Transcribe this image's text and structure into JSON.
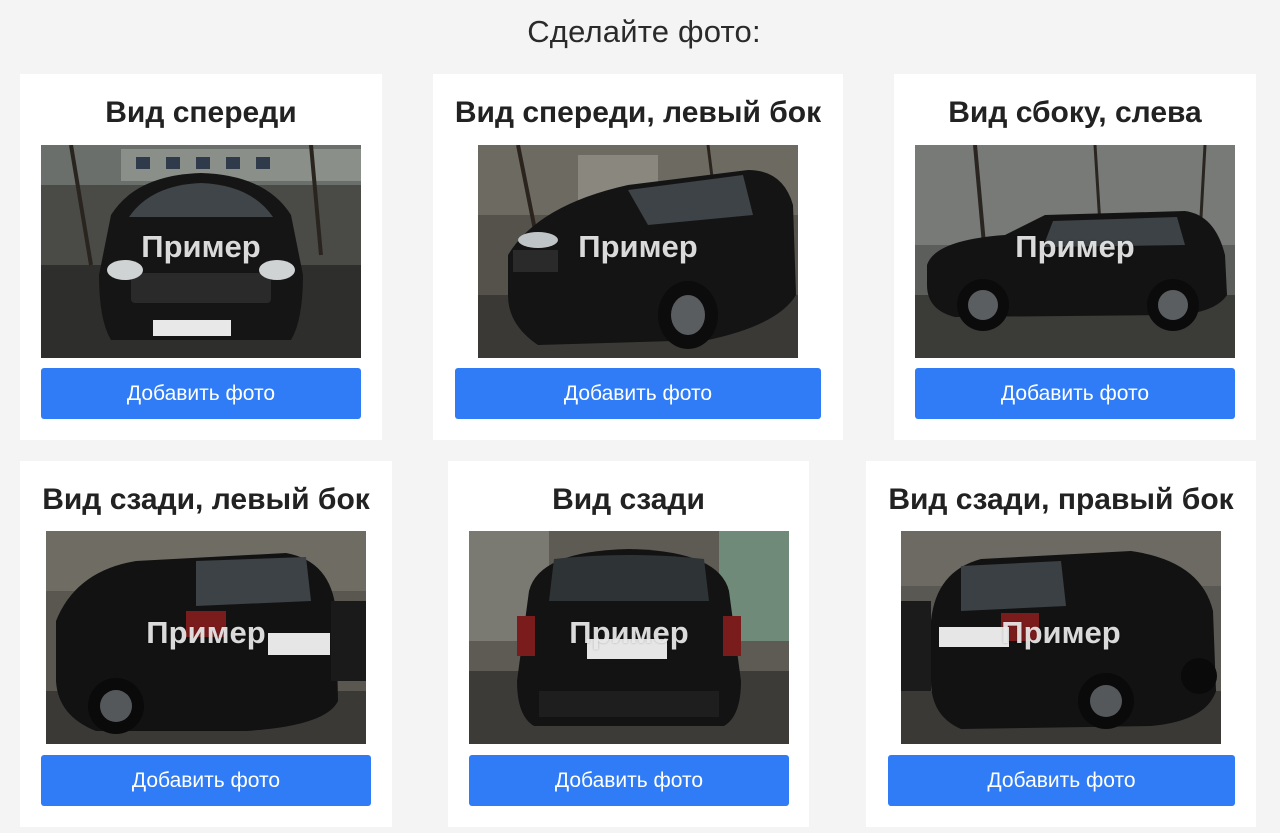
{
  "page": {
    "title": "Сделайте фото:"
  },
  "cards": [
    {
      "title": "Вид спереди",
      "example": "Пример",
      "button": "Добавить фото"
    },
    {
      "title": "Вид спереди, левый бок",
      "example": "Пример",
      "button": "Добавить фото"
    },
    {
      "title": "Вид сбоку, слева",
      "example": "Пример",
      "button": "Добавить фото"
    },
    {
      "title": "Вид сзади, левый бок",
      "example": "Пример",
      "button": "Добавить фото"
    },
    {
      "title": "Вид сзади",
      "example": "Пример",
      "button": "Добавить фото"
    },
    {
      "title": "Вид сзади, правый бок",
      "example": "Пример",
      "button": "Добавить фото"
    }
  ],
  "colors": {
    "background": "#f4f4f4",
    "card": "#ffffff",
    "button": "#2f7cf6",
    "button_text": "#ffffff"
  }
}
